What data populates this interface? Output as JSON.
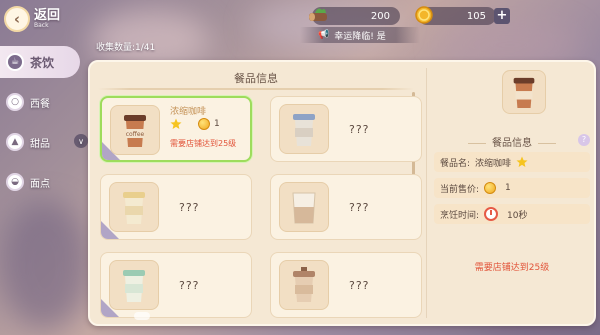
{
  "header": {
    "back_label": "返回",
    "back_sub": "Back",
    "wood_amount": "200",
    "coin_amount": "105",
    "lucky_text": "幸运降临! 是"
  },
  "collect": {
    "label": "收集数量:1/41"
  },
  "nav": {
    "items": [
      {
        "label": "茶饮",
        "icon": "cup-icon",
        "active": true
      },
      {
        "label": "西餐",
        "icon": "plate-icon",
        "active": false
      },
      {
        "label": "甜品",
        "icon": "cake-icon",
        "active": false
      },
      {
        "label": "面点",
        "icon": "bun-icon",
        "active": false
      }
    ]
  },
  "panel": {
    "title": "餐品信息",
    "cards": [
      {
        "name": "浓缩咖啡",
        "price": "1",
        "requirement": "需要店铺达到25级",
        "unlocked": true,
        "lid": "#7a4a34",
        "cup": "#c77b4f"
      },
      {
        "hidden": "???",
        "lid": "#8ea3c6",
        "cup": "#e8e2d8"
      },
      {
        "hidden": "???",
        "lid": "#e9cf8d",
        "cup": "#f4ead0"
      },
      {
        "hidden": "???",
        "lid": "#d6b89a",
        "cup": "#f1e6d2"
      },
      {
        "hidden": "???",
        "lid": "#9bcbb3",
        "cup": "#eef0e2"
      },
      {
        "hidden": "???",
        "lid": "#b08468",
        "cup": "#e6cdb2"
      }
    ]
  },
  "details": {
    "heading": "餐品信息",
    "name_label": "餐品名:",
    "name_value": "浓缩咖啡",
    "price_label": "当前售价:",
    "price_value": "1",
    "time_label": "烹饪时间:",
    "time_value": "10秒",
    "requirement": "需要店铺达到25级"
  },
  "colors": {
    "panel_bg": "#f5e8d4",
    "select_border": "#9edc5c",
    "warning": "#e2543a"
  }
}
